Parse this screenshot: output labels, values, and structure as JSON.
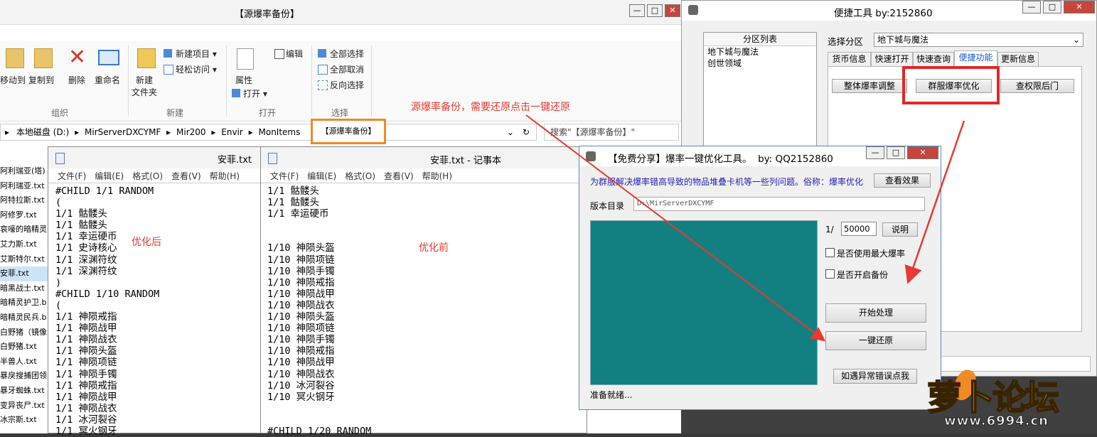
{
  "explorer": {
    "title": "【源爆率备份】",
    "controls": [
      "—",
      "□",
      "✕"
    ],
    "ribbon": {
      "move_to": "移动到",
      "copy_to": "复制到",
      "delete": "删除",
      "rename": "重命名",
      "new_folder_l1": "新建",
      "new_folder_l2": "文件夹",
      "new_item": "新建项目 ▾",
      "easy_access": "轻松访问 ▾",
      "properties": "属性",
      "open": "打开 ▾",
      "edit": "编辑",
      "select_all": "全部选择",
      "select_none": "全部取消",
      "invert": "反向选择",
      "group_organize": "组织",
      "group_new": "新建",
      "group_open": "打开",
      "group_select": "选择"
    },
    "address": {
      "segments": [
        "本地磁盘 (D:)",
        "MirServerDXCYMF",
        "Mir200",
        "Envir",
        "MonItems"
      ],
      "highlighted": "【源爆率备份】",
      "search_placeholder": "搜索\"【源爆率备份】\""
    },
    "files": [
      "阿利瑞亚(塔)",
      "阿利瑞亚.txt",
      "阿特拉斯.txt",
      "阿修罗.txt",
      "哀嚎的暗精灵",
      "艾力斯.txt",
      "艾斯特尔.txt",
      "安菲.txt",
      "暗黑战士.txt",
      "暗精灵护卫.b",
      "暗精灵民兵.b",
      "白野猪（镜像",
      "白野猪.txt",
      "半兽人.txt",
      "暴戾搜捕团领",
      "暴牙蜘蛛.txt",
      "变异丧尸.txt",
      "冰宗斯.txt"
    ]
  },
  "annotation": {
    "backup_note": "源爆率备份，需要还原点击一键还原",
    "after": "优化后",
    "before": "优化前"
  },
  "notepad_left": {
    "title": "安菲.txt",
    "menu": [
      "文件(F)",
      "编辑(E)",
      "格式(O)",
      "查看(V)",
      "帮助(H)"
    ],
    "lines": [
      "#CHILD 1/1 RANDOM",
      "(",
      "1/1 骷髅头",
      "1/1 骷髅头",
      "1/1 幸运硬币",
      "1/1 史诗核心",
      "1/1 深渊符纹",
      "1/1 深渊符纹",
      ")",
      "#CHILD 1/10 RANDOM",
      "(",
      "1/1 神陨戒指",
      "1/1 神陨战甲",
      "1/1 神陨战衣",
      "1/1 神陨头盔",
      "1/1 神陨项链",
      "1/1 神陨手镯",
      "1/1 神陨戒指",
      "1/1 神陨战甲",
      "1/1 神陨战衣",
      "1/1 冰河裂谷",
      "1/1 冥火钢牙"
    ]
  },
  "notepad_right": {
    "title": "安菲.txt - 记事本",
    "menu": [
      "文件(F)",
      "编辑(E)",
      "格式(O)",
      "查看(V)",
      "帮助(H)"
    ],
    "lines": [
      "1/1 骷髅头",
      "1/1 骷髅头",
      "1/1 幸运硬币",
      "",
      "",
      "1/10 神陨头盔",
      "1/10 神陨项链",
      "1/10 神陨手镯",
      "1/10 神陨戒指",
      "1/10 神陨战甲",
      "1/10 神陨战衣",
      "1/10 神陨头盔",
      "1/10 神陨项链",
      "1/10 神陨手镯",
      "1/10 神陨戒指",
      "1/10 神陨战甲",
      "1/10 神陨战衣",
      "1/10 冰河裂谷",
      "1/10 冥火钢牙",
      "",
      "",
      "#CHILD 1/20 RANDOM"
    ]
  },
  "tools": {
    "title": "便捷工具 by:2152860",
    "partition_header": "分区列表",
    "partitions": [
      "地下城与魔法",
      "创世领域"
    ],
    "select_label": "选择分区",
    "select_value": "地下城与魔法",
    "tabs": [
      "货币信息",
      "快速打开",
      "快速查询",
      "便捷功能",
      "更新信息"
    ],
    "buttons": [
      "整体爆率调整",
      "群服爆率优化",
      "查权限后门"
    ]
  },
  "optimizer": {
    "title": "【免费分享】爆率一键优化工具。  by: QQ2152860",
    "description": "为群服解决爆率错高导致的物品堆叠卡机等一些列问题。俗称：爆率优化",
    "view_effect": "查看效果",
    "version_label": "版本目录",
    "version_value": "D:\\MirServerDXCYMF",
    "ratio_label": "1/",
    "ratio_value": "50000",
    "explain": "说明",
    "opt_max": "是否使用最大爆率",
    "opt_backup": "是否开启备份",
    "start": "开始处理",
    "restore": "一键还原",
    "error_btn": "如遇异常错误点我",
    "status": "准备就绪..."
  },
  "watermark": {
    "name": "萝卜论坛",
    "url": "www.6994.cn"
  }
}
